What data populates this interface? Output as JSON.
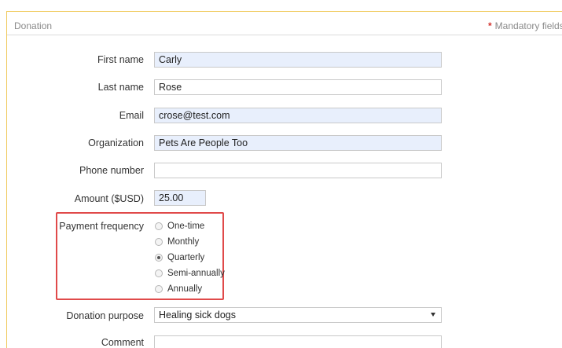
{
  "header": {
    "title": "Donation",
    "mandatory_star": "*",
    "mandatory_label": "Mandatory fields"
  },
  "fields": {
    "first_name": {
      "label": "First name",
      "value": "Carly"
    },
    "last_name": {
      "label": "Last name",
      "value": "Rose"
    },
    "email": {
      "label": "Email",
      "value": "crose@test.com"
    },
    "organization": {
      "label": "Organization",
      "value": "Pets Are People Too"
    },
    "phone": {
      "label": "Phone number",
      "value": ""
    },
    "amount": {
      "label": "Amount ($USD)",
      "value": "25.00"
    },
    "payment_frequency": {
      "label": "Payment frequency",
      "options": [
        "One-time",
        "Monthly",
        "Quarterly",
        "Semi-annually",
        "Annually"
      ],
      "selected": "Quarterly"
    },
    "donation_purpose": {
      "label": "Donation purpose",
      "value": "Healing sick dogs"
    },
    "comment": {
      "label": "Comment",
      "value": ""
    }
  },
  "colors": {
    "highlight_box": "#e04a4a",
    "autofill_bg": "#e8effc",
    "panel_border": "#f0c95a"
  }
}
